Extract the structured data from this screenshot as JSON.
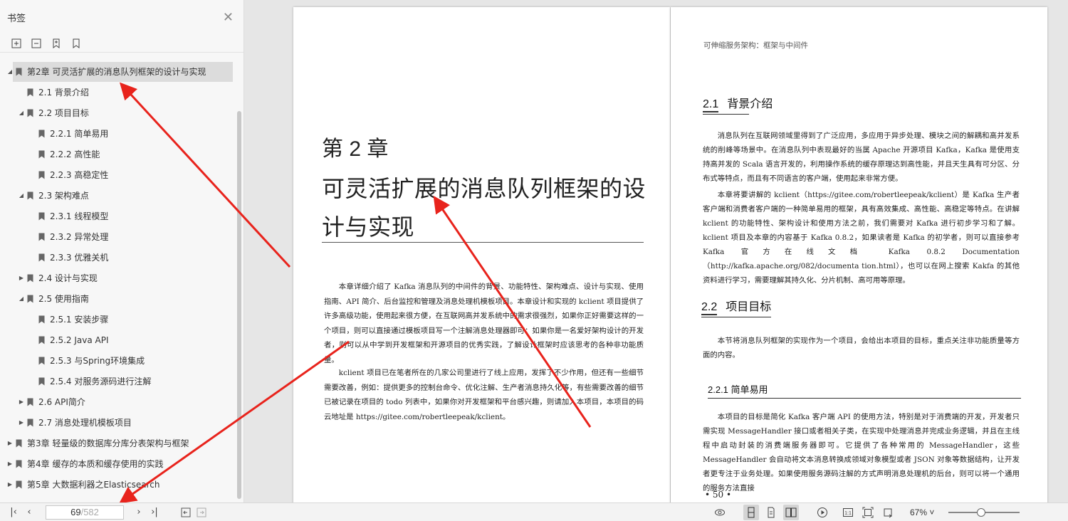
{
  "sidebar": {
    "title": "书签",
    "items": [
      {
        "label": "第2章 可灵活扩展的消息队列框架的设计与实现",
        "level": 0,
        "caret": "down",
        "selected": true
      },
      {
        "label": "2.1 背景介绍",
        "level": 1,
        "caret": "none"
      },
      {
        "label": "2.2 项目目标",
        "level": 1,
        "caret": "down"
      },
      {
        "label": "2.2.1 简单易用",
        "level": 2,
        "caret": "none"
      },
      {
        "label": "2.2.2 高性能",
        "level": 2,
        "caret": "none"
      },
      {
        "label": "2.2.3 高稳定性",
        "level": 2,
        "caret": "none"
      },
      {
        "label": "2.3 架构难点",
        "level": 1,
        "caret": "down"
      },
      {
        "label": "2.3.1 线程模型",
        "level": 2,
        "caret": "none"
      },
      {
        "label": "2.3.2 异常处理",
        "level": 2,
        "caret": "none"
      },
      {
        "label": "2.3.3 优雅关机",
        "level": 2,
        "caret": "none"
      },
      {
        "label": "2.4 设计与实现",
        "level": 1,
        "caret": "right"
      },
      {
        "label": "2.5 使用指南",
        "level": 1,
        "caret": "down"
      },
      {
        "label": "2.5.1 安装步骤",
        "level": 2,
        "caret": "none"
      },
      {
        "label": "2.5.2 Java API",
        "level": 2,
        "caret": "none"
      },
      {
        "label": "2.5.3 与Spring环境集成",
        "level": 2,
        "caret": "none"
      },
      {
        "label": "2.5.4 对服务源码进行注解",
        "level": 2,
        "caret": "none"
      },
      {
        "label": "2.6 API简介",
        "level": 1,
        "caret": "right"
      },
      {
        "label": "2.7 消息处理机模板项目",
        "level": 1,
        "caret": "right"
      },
      {
        "label": "第3章 轻量级的数据库分库分表架构与框架",
        "level": 0,
        "caret": "right"
      },
      {
        "label": "第4章 缓存的本质和缓存使用的实践",
        "level": 0,
        "caret": "right"
      },
      {
        "label": "第5章 大数据利器之Elasticsearch",
        "level": 0,
        "caret": "right"
      }
    ]
  },
  "left_page": {
    "chapter_number": "第 2 章",
    "chapter_title": "可灵活扩展的消息队列框架的设计与实现",
    "paragraph1": "本章详细介绍了 Kafka 消息队列的中间件的背景、功能特性、架构难点、设计与实现、使用指南、API 简介、后台监控和管理及消息处理机模板项目。本章设计和实现的 kclient 项目提供了许多高级功能，使用起来很方便，在互联网高并发系统中的需求很强烈，如果你正好需要这样的一个项目，则可以直接通过模板项目写一个注解消息处理器即可；如果你是一名爱好架构设计的开发者，则可以从中学到开发框架和开源项目的优秀实践，了解设计框架时应该思考的各种非功能质量。",
    "paragraph2": "kclient 项目已在笔者所在的几家公司里进行了线上应用，发挥了不少作用，但还有一些细节需要改善，例如：提供更多的控制台命令、优化注解、生产者消息持久化等，有些需要改善的细节已被记录在项目的 todo 列表中，如果你对开发框架和平台感兴趣，则请加入本项目，本项目的码云地址是 https://gitee.com/robertleepeak/kclient。"
  },
  "right_page": {
    "running_header": "可伸缩服务架构：框架与中间件",
    "sec21_num": "2.1",
    "sec21_title": "背景介绍",
    "sec21_p1": "消息队列在互联网领域里得到了广泛应用，多应用于异步处理、模块之间的解耦和高并发系统的削峰等场景中。在消息队列中表现最好的当属 Apache 开源项目 Kafka，Kafka 是使用支持高并发的 Scala 语言开发的，利用操作系统的缓存原理达到高性能，并且天生具有可分区、分布式等特点，而且有不同语言的客户端，使用起来非常方便。",
    "sec21_p2": "本章将要讲解的 kclient（https://gitee.com/robertleepeak/kclient）是 Kafka 生产者客户端和消费者客户端的一种简单易用的框架，具有高效集成、高性能、高稳定等特点。在讲解 kclient 的功能特性、架构设计和使用方法之前，我们需要对 Kafka 进行初步学习和了解。kclient 项目及本章的内容基于 Kafka 0.8.2，如果读者是 Kafka 的初学者，则可以直接参考 Kafka 官方在线文档 Kafka 0.8.2 Documentation（http://kafka.apache.org/082/documenta tion.html），也可以在网上搜索 Kakfa 的其他资料进行学习，需要理解其持久化、分片机制、高可用等原理。",
    "sec22_num": "2.2",
    "sec22_title": "项目目标",
    "sec22_p1": "本节将消息队列框架的实现作为一个项目，会给出本项目的目标，重点关注非功能质量等方面的内容。",
    "sec221_title": "2.2.1   简单易用",
    "sec221_p1": "本项目的目标是简化 Kafka 客户端 API 的使用方法，特别是对于消费端的开发，开发者只需实现 MessageHandler 接口或者相关子类，在实现中处理消息并完成业务逻辑，并且在主线程中启动封装的消费端服务器即可。它提供了各种常用的 MessageHandler，这些 MessageHandler 会自动将文本消息转换成领域对象模型或者 JSON 对象等数据结构，让开发者更专注于业务处理。如果使用服务源码注解的方式声明消息处理机的后台，则可以将一个通用的服务方法直接",
    "page_number": "• 50 •"
  },
  "statusbar": {
    "current_page": "69",
    "total_pages": "/582",
    "zoom": "67% ˅",
    "zoom_fraction": 0.46
  },
  "colors": {
    "arrow": "#e8231c",
    "selection": "#dcdcdc"
  }
}
